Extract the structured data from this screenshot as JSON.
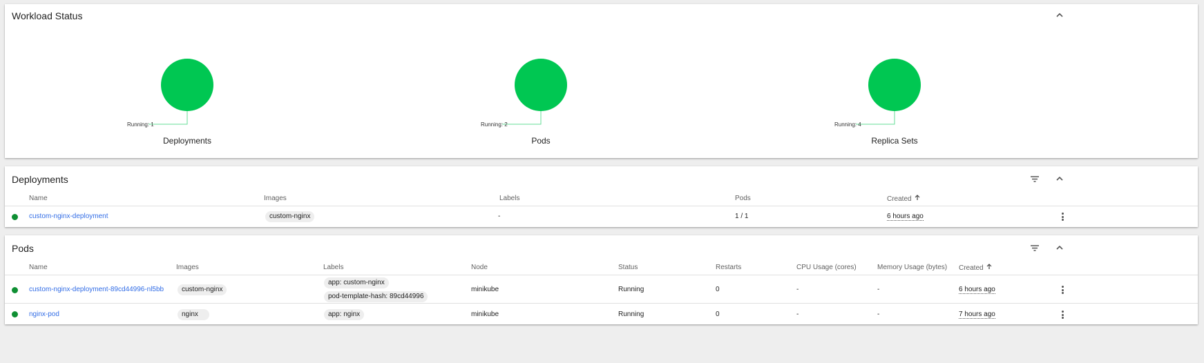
{
  "workload_status": {
    "title": "Workload Status",
    "accent_color": "#00c752",
    "items": [
      {
        "caption": "Deployments",
        "running_label": "Running: 1",
        "running": 1
      },
      {
        "caption": "Pods",
        "running_label": "Running: 2",
        "running": 2
      },
      {
        "caption": "Replica Sets",
        "running_label": "Running: 4",
        "running": 4
      }
    ]
  },
  "deployments": {
    "title": "Deployments",
    "columns": {
      "name": "Name",
      "images": "Images",
      "labels": "Labels",
      "pods": "Pods",
      "created": "Created"
    },
    "sort_icon": "arrow-up-icon",
    "rows": [
      {
        "status": "running",
        "name": "custom-nginx-deployment",
        "image": "custom-nginx",
        "labels": "-",
        "pods": "1 / 1",
        "created": "6 hours ago"
      }
    ]
  },
  "pods": {
    "title": "Pods",
    "columns": {
      "name": "Name",
      "images": "Images",
      "labels": "Labels",
      "node": "Node",
      "status": "Status",
      "restarts": "Restarts",
      "cpu": "CPU Usage (cores)",
      "memory": "Memory Usage (bytes)",
      "created": "Created"
    },
    "rows": [
      {
        "status_dot": "running",
        "name": "custom-nginx-deployment-89cd44996-nl5bb",
        "image": "custom-nginx",
        "labels": [
          "app: custom-nginx",
          "pod-template-hash: 89cd44996"
        ],
        "node": "minikube",
        "status": "Running",
        "restarts": "0",
        "cpu": "-",
        "memory": "-",
        "created": "6 hours ago"
      },
      {
        "status_dot": "running",
        "name": "nginx-pod",
        "image": "nginx",
        "labels": [
          "app: nginx"
        ],
        "node": "minikube",
        "status": "Running",
        "restarts": "0",
        "cpu": "-",
        "memory": "-",
        "created": "7 hours ago"
      }
    ]
  },
  "icons": {
    "collapse": "chevron-up-icon",
    "filter": "filter-icon",
    "menu": "more-vert-icon"
  }
}
